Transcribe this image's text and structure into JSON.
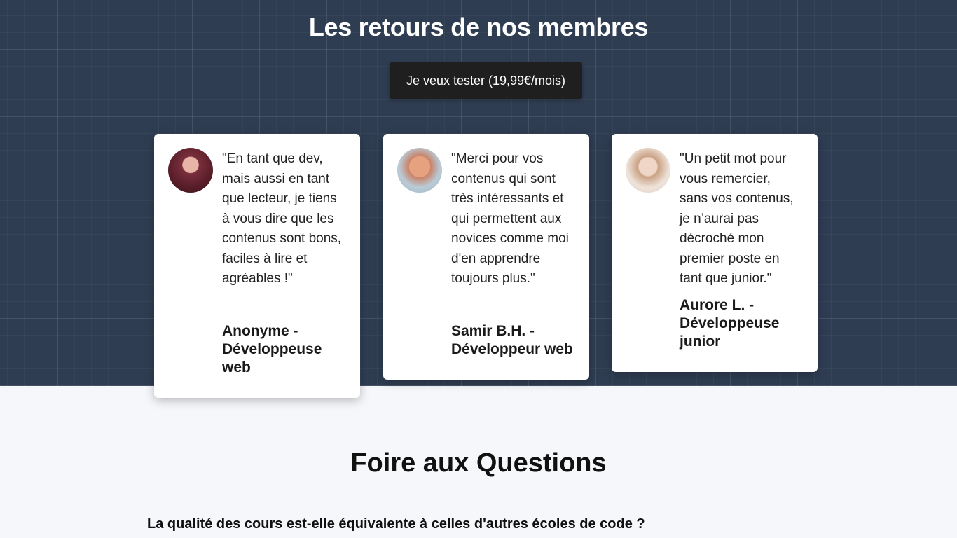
{
  "testimonials": {
    "title": "Les retours de nos membres",
    "cta_label": "Je veux tester (19,99€/mois)",
    "items": [
      {
        "quote": "\"En tant que dev, mais aussi en tant que lecteur, je tiens à vous dire que les contenus sont bons, faciles à lire et agréables !\"",
        "author": "Anonyme - Développeuse web"
      },
      {
        "quote": "\"Merci pour vos contenus qui sont très intéressants et qui permettent aux novices comme moi d'en apprendre toujours plus.\"",
        "author": "Samir B.H. - Développeur web"
      },
      {
        "quote": "\"Un petit mot pour vous remercier, sans vos contenus, je n’aurai pas décroché mon premier poste en tant que junior.\"",
        "author": "Aurore L. - Développeuse junior"
      }
    ]
  },
  "faq": {
    "title": "Foire aux Questions",
    "questions": [
      "La qualité des cours est-elle équivalente à celles d'autres écoles de code ?"
    ]
  }
}
